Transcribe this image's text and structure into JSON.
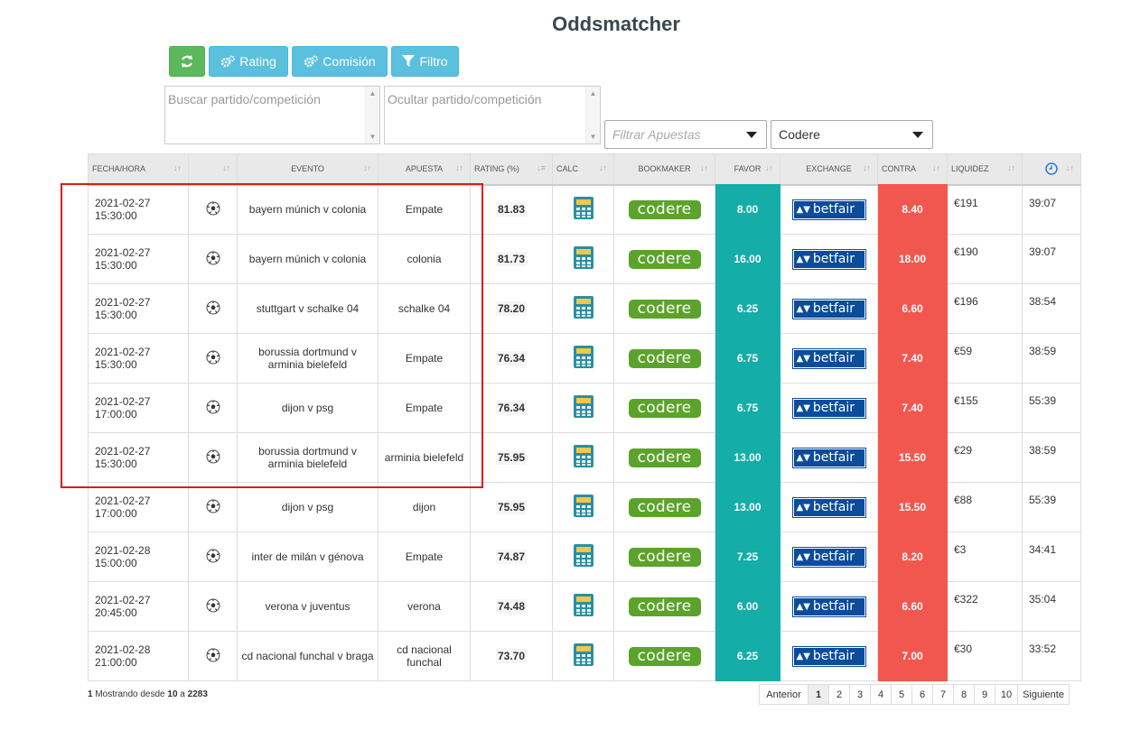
{
  "page_title": "Oddsmatcher",
  "toolbar": {
    "refresh_icon": "refresh-icon",
    "rating_label": "Rating",
    "comision_label": "Comisión",
    "filtro_label": "Filtro"
  },
  "search": {
    "placeholder": "Buscar partido/competición"
  },
  "hide": {
    "placeholder": "Ocultar partido/competición"
  },
  "filter_bets": {
    "placeholder": "Filtrar Apuestas"
  },
  "bookmaker_select": {
    "value": "Codere"
  },
  "columns": {
    "fecha": "FECHA/HORA",
    "sport": "",
    "evento": "EVENTO",
    "apuesta": "APUESTA",
    "rating": "RATING (%)",
    "calc": "CALC",
    "bookmaker": "BOOKMAKER",
    "favor": "FAVOR",
    "exchange": "EXCHANGE",
    "contra": "CONTRA",
    "liquidez": "LIQUIDEZ",
    "time_icon": "clock-icon"
  },
  "bookmaker_logo_text": "codere",
  "exchange_logo_text": "betfair",
  "rows": [
    {
      "date": "2021-02-27",
      "time": "15:30:00",
      "event": "bayern múnich v colonia",
      "bet": "Empate",
      "rating": "81.83",
      "favor": "8.00",
      "contra": "8.40",
      "liquidez": "€191",
      "remaining": "39:07"
    },
    {
      "date": "2021-02-27",
      "time": "15:30:00",
      "event": "bayern múnich v colonia",
      "bet": "colonia",
      "rating": "81.73",
      "favor": "16.00",
      "contra": "18.00",
      "liquidez": "€190",
      "remaining": "39:07"
    },
    {
      "date": "2021-02-27",
      "time": "15:30:00",
      "event": "stuttgart v schalke 04",
      "bet": "schalke 04",
      "rating": "78.20",
      "favor": "6.25",
      "contra": "6.60",
      "liquidez": "€196",
      "remaining": "38:54"
    },
    {
      "date": "2021-02-27",
      "time": "15:30:00",
      "event": "borussia dortmund v arminia bielefeld",
      "bet": "Empate",
      "rating": "76.34",
      "favor": "6.75",
      "contra": "7.40",
      "liquidez": "€59",
      "remaining": "38:59"
    },
    {
      "date": "2021-02-27",
      "time": "17:00:00",
      "event": "dijon v psg",
      "bet": "Empate",
      "rating": "76.34",
      "favor": "6.75",
      "contra": "7.40",
      "liquidez": "€155",
      "remaining": "55:39"
    },
    {
      "date": "2021-02-27",
      "time": "15:30:00",
      "event": "borussia dortmund v arminia bielefeld",
      "bet": "arminia bielefeld",
      "rating": "75.95",
      "favor": "13.00",
      "contra": "15.50",
      "liquidez": "€29",
      "remaining": "38:59"
    },
    {
      "date": "2021-02-27",
      "time": "17:00:00",
      "event": "dijon v psg",
      "bet": "dijon",
      "rating": "75.95",
      "favor": "13.00",
      "contra": "15.50",
      "liquidez": "€88",
      "remaining": "55:39"
    },
    {
      "date": "2021-02-28",
      "time": "15:00:00",
      "event": "inter de milán v génova",
      "bet": "Empate",
      "rating": "74.87",
      "favor": "7.25",
      "contra": "8.20",
      "liquidez": "€3",
      "remaining": "34:41"
    },
    {
      "date": "2021-02-27",
      "time": "20:45:00",
      "event": "verona v juventus",
      "bet": "verona",
      "rating": "74.48",
      "favor": "6.00",
      "contra": "6.60",
      "liquidez": "€322",
      "remaining": "35:04"
    },
    {
      "date": "2021-02-28",
      "time": "21:00:00",
      "event": "cd nacional funchal v braga",
      "bet": "cd nacional funchal",
      "rating": "73.70",
      "favor": "6.25",
      "contra": "7.00",
      "liquidez": "€30",
      "remaining": "33:52"
    }
  ],
  "footer": {
    "page": "1",
    "text_a": " Mostrando desde ",
    "from": "10",
    "text_b": " a ",
    "total": "2283"
  },
  "pagination": {
    "prev": "Anterior",
    "pages": [
      "1",
      "2",
      "3",
      "4",
      "5",
      "6",
      "7",
      "8",
      "9",
      "10"
    ],
    "next": "Siguiente",
    "active": "1"
  },
  "colors": {
    "favor": "#14ada8",
    "contra": "#f2574f",
    "codere": "#5ba32a",
    "betfair": "#0b4c9b",
    "highlight": "#e0191d"
  }
}
